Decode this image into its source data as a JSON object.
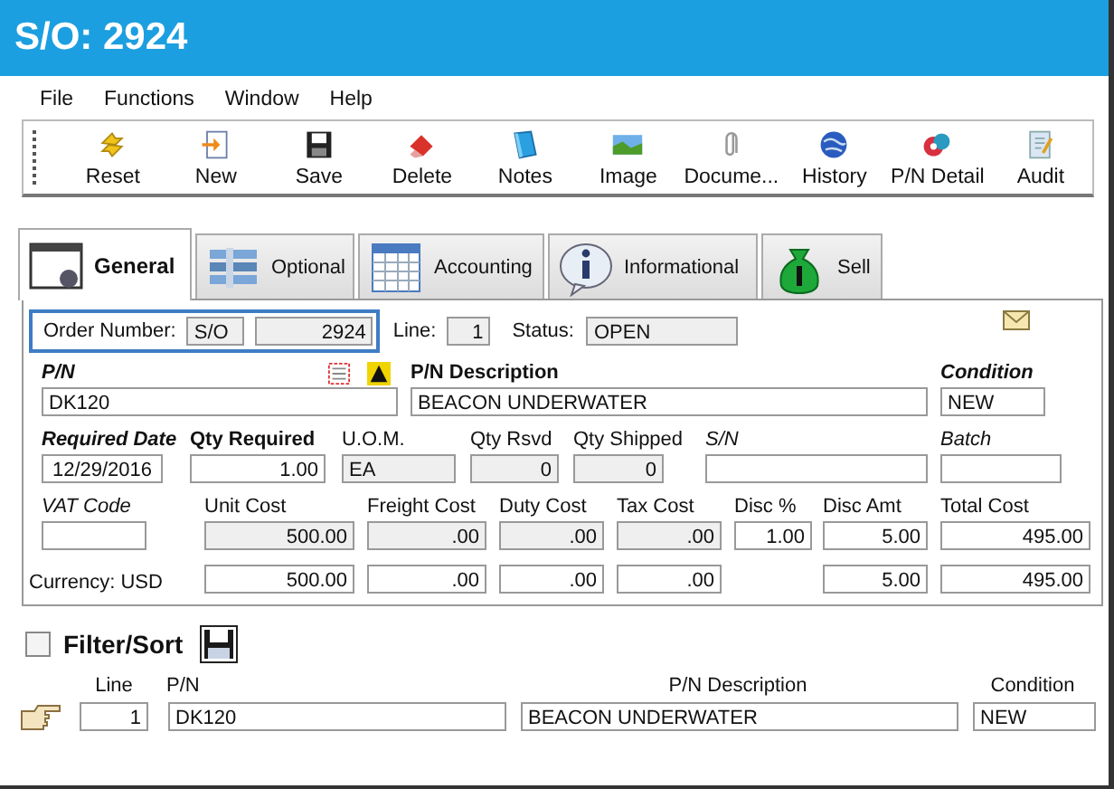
{
  "window": {
    "title": "S/O: 2924"
  },
  "menu": [
    "File",
    "Functions",
    "Window",
    "Help"
  ],
  "toolbar": [
    {
      "label": "Reset"
    },
    {
      "label": "New"
    },
    {
      "label": "Save"
    },
    {
      "label": "Delete"
    },
    {
      "label": "Notes"
    },
    {
      "label": "Image"
    },
    {
      "label": "Docume..."
    },
    {
      "label": "History"
    },
    {
      "label": "P/N Detail"
    },
    {
      "label": "Audit"
    }
  ],
  "tabs": [
    {
      "label": "General",
      "selected": true
    },
    {
      "label": "Optional",
      "selected": false
    },
    {
      "label": "Accounting",
      "selected": false
    },
    {
      "label": "Informational",
      "selected": false
    },
    {
      "label": "Sell",
      "selected": false
    }
  ],
  "order": {
    "label": "Order Number:",
    "prefix": "S/O",
    "number": "2924",
    "line_label": "Line:",
    "line": "1",
    "status_label": "Status:",
    "status": "OPEN"
  },
  "rows": [
    [
      {
        "label": "P/N",
        "value": "DK120",
        "kind": "text",
        "readonly": false
      },
      {
        "label": "P/N Description",
        "value": "BEACON UNDERWATER",
        "kind": "text",
        "readonly": false
      },
      {
        "label": "Condition",
        "value": "NEW",
        "kind": "text",
        "readonly": false
      }
    ],
    [
      {
        "label": "Required Date",
        "value": "12/29/2016",
        "kind": "date",
        "readonly": false
      },
      {
        "label": "Qty Required",
        "value": "1.00",
        "kind": "number",
        "readonly": false
      },
      {
        "label": "U.O.M.",
        "value": "EA",
        "kind": "text",
        "readonly": true
      },
      {
        "label": "Qty Rsvd",
        "value": "0",
        "kind": "number",
        "readonly": true
      },
      {
        "label": "Qty Shipped",
        "value": "0",
        "kind": "number",
        "readonly": true
      },
      {
        "label": "S/N",
        "kind": "text",
        "readonly": false
      },
      {
        "label": "Batch",
        "kind": "text",
        "readonly": false
      }
    ],
    [
      {
        "label": "VAT Code",
        "kind": "text",
        "readonly": false
      },
      {
        "label": "Unit Cost",
        "value": "500.00",
        "kind": "number",
        "readonly": true
      },
      {
        "label": "Freight Cost",
        "value": ".00",
        "kind": "number",
        "readonly": true
      },
      {
        "label": "Duty Cost",
        "value": ".00",
        "kind": "number",
        "readonly": true
      },
      {
        "label": "Tax Cost",
        "value": ".00",
        "kind": "number",
        "readonly": true
      },
      {
        "label": "Disc %",
        "value": "1.00",
        "kind": "number",
        "readonly": false
      },
      {
        "label": "Disc Amt",
        "value": "5.00",
        "kind": "number",
        "readonly": false
      },
      {
        "label": "Total Cost",
        "value": "495.00",
        "kind": "number",
        "readonly": false
      }
    ]
  ],
  "currency": {
    "label": "Currency: USD",
    "values": [
      "500.00",
      ".00",
      ".00",
      ".00",
      "5.00",
      "495.00"
    ]
  },
  "filter": {
    "label": "Filter/Sort",
    "checked": false
  },
  "grid": {
    "columns": [
      "Line",
      "P/N",
      "P/N Description",
      "Condition"
    ],
    "rows": [
      {
        "line": "1",
        "pn": "DK120",
        "description": "BEACON UNDERWATER",
        "condition": "NEW"
      }
    ]
  }
}
